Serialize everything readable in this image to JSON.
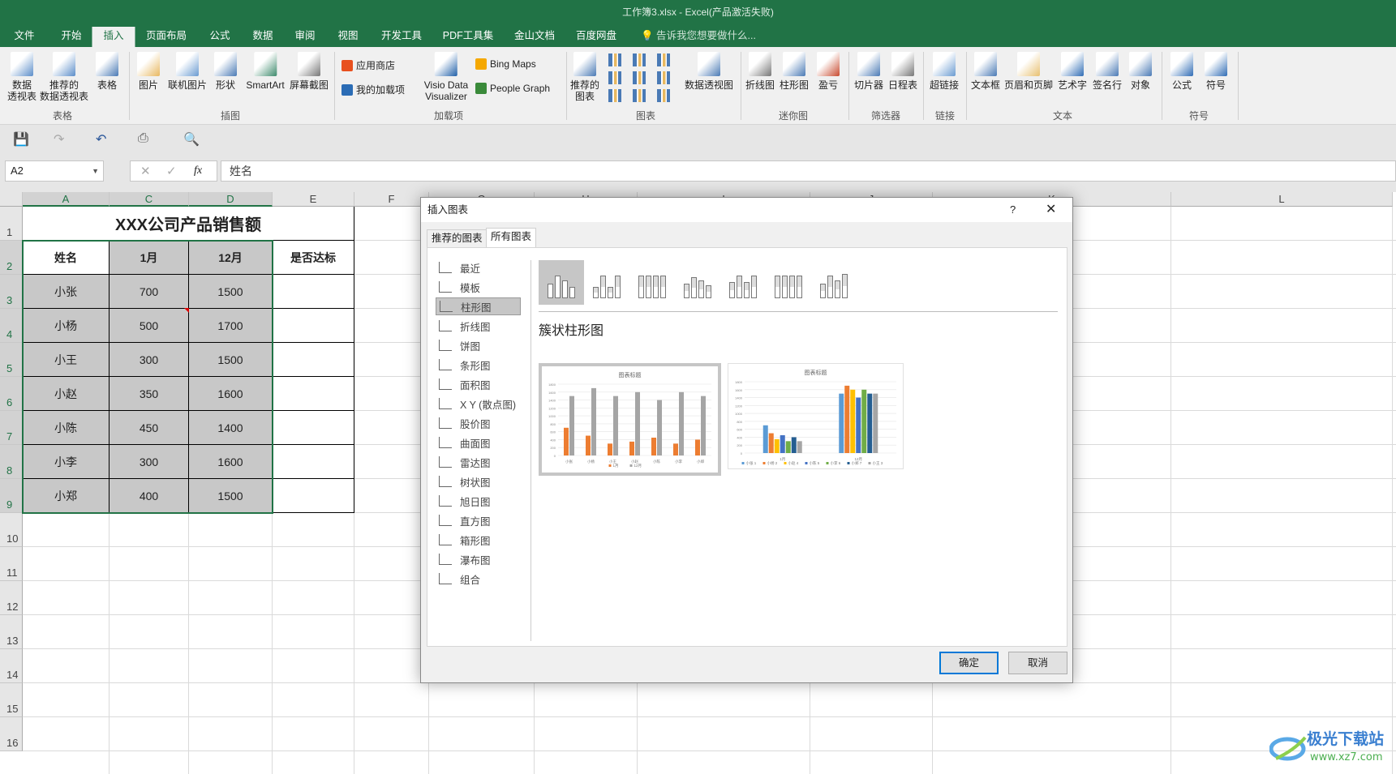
{
  "window": {
    "title": "工作簿3.xlsx - Excel(产品激活失败)"
  },
  "tabs": [
    "文件",
    "开始",
    "插入",
    "页面布局",
    "公式",
    "数据",
    "审阅",
    "视图",
    "开发工具",
    "PDF工具集",
    "金山文档",
    "百度网盘"
  ],
  "active_tab": "插入",
  "tell_me": "告诉我您想要做什么...",
  "ribbon": {
    "buttons": [
      "数据\n透视表",
      "推荐的\n数据透视表",
      "表格",
      "图片",
      "联机图片",
      "形状",
      "SmartArt",
      "屏幕截图",
      "Visio Data\nVisualizer",
      "推荐的\n图表",
      "数据透视图",
      "折线图",
      "柱形图",
      "盈亏",
      "切片器",
      "日程表",
      "超链接",
      "文本框",
      "页眉和页脚",
      "艺术字",
      "签名行",
      "对象",
      "公式",
      "符号"
    ],
    "small_buttons": [
      "应用商店",
      "我的加载项",
      "Bing Maps",
      "People Graph"
    ],
    "groups": [
      "表格",
      "插图",
      "加载项",
      "图表",
      "迷你图",
      "筛选器",
      "链接",
      "文本",
      "符号"
    ]
  },
  "formula_bar": {
    "name_box": "A2",
    "value": "姓名",
    "fx": "fx"
  },
  "sheet": {
    "columns": [
      "A",
      "C",
      "D",
      "E",
      "F",
      "G",
      "H",
      "I",
      "J",
      "K",
      "L"
    ],
    "rows": [
      "1",
      "2",
      "3",
      "4",
      "5",
      "6",
      "7",
      "8",
      "9",
      "10",
      "11",
      "12",
      "13",
      "14",
      "15",
      "16"
    ],
    "title": "XXX公司产品销售额",
    "headers": [
      "姓名",
      "1月",
      "12月",
      "是否达标"
    ],
    "data": [
      [
        "小张",
        "700",
        "1500",
        ""
      ],
      [
        "小杨",
        "500",
        "1700",
        ""
      ],
      [
        "小王",
        "300",
        "1500",
        ""
      ],
      [
        "小赵",
        "350",
        "1600",
        ""
      ],
      [
        "小陈",
        "450",
        "1400",
        ""
      ],
      [
        "小李",
        "300",
        "1600",
        ""
      ],
      [
        "小郑",
        "400",
        "1500",
        ""
      ]
    ]
  },
  "dialog": {
    "title": "插入图表",
    "help": "?",
    "tabs": [
      "推荐的图表",
      "所有图表"
    ],
    "active_tab": "所有图表",
    "chart_types": [
      "最近",
      "模板",
      "柱形图",
      "折线图",
      "饼图",
      "条形图",
      "面积图",
      "X Y (散点图)",
      "股价图",
      "曲面图",
      "雷达图",
      "树状图",
      "旭日图",
      "直方图",
      "箱形图",
      "瀑布图",
      "组合"
    ],
    "selected_type": "柱形图",
    "subtype_title": "簇状柱形图",
    "ok": "确定",
    "cancel": "取消",
    "preview1": {
      "title": "图表标题",
      "categories": [
        "小张",
        "小杨",
        "小王",
        "小赵",
        "小陈",
        "小李",
        "小郑"
      ],
      "series": [
        {
          "name": "1月",
          "values": [
            700,
            500,
            300,
            350,
            450,
            300,
            400
          ],
          "color": "#ed7d31"
        },
        {
          "name": "12月",
          "values": [
            1500,
            1700,
            1500,
            1600,
            1400,
            1600,
            1500
          ],
          "color": "#a5a5a5"
        }
      ],
      "yticks": [
        "0",
        "200",
        "400",
        "600",
        "800",
        "1000",
        "1200",
        "1400",
        "1600",
        "1800"
      ]
    },
    "preview2": {
      "title": "图表标题",
      "categories": [
        "1月",
        "12月"
      ],
      "series": [
        {
          "name": "小张 1",
          "values": [
            700,
            1500
          ],
          "color": "#5b9bd5"
        },
        {
          "name": "小杨 2",
          "values": [
            500,
            1700
          ],
          "color": "#ed7d31"
        },
        {
          "name": "小赵 4",
          "values": [
            350,
            1600
          ],
          "color": "#ffc000"
        },
        {
          "name": "小陈 5",
          "values": [
            450,
            1400
          ],
          "color": "#4472c4"
        },
        {
          "name": "小李 6",
          "values": [
            300,
            1600
          ],
          "color": "#70ad47"
        },
        {
          "name": "小郑 7",
          "values": [
            400,
            1500
          ],
          "color": "#255e91"
        },
        {
          "name": "小王 3",
          "values": [
            300,
            1500
          ],
          "color": "#a5a5a5"
        }
      ],
      "yticks": [
        "0",
        "200",
        "400",
        "600",
        "800",
        "1000",
        "1200",
        "1400",
        "1600",
        "1800"
      ]
    }
  },
  "watermark": {
    "name": "极光下载站",
    "url": "www.xz7.com"
  },
  "colors": {
    "excel_green": "#217346",
    "selection": "#217346",
    "cell_fill": "#c8c8c8",
    "dialog_primary": "#0078d7"
  }
}
